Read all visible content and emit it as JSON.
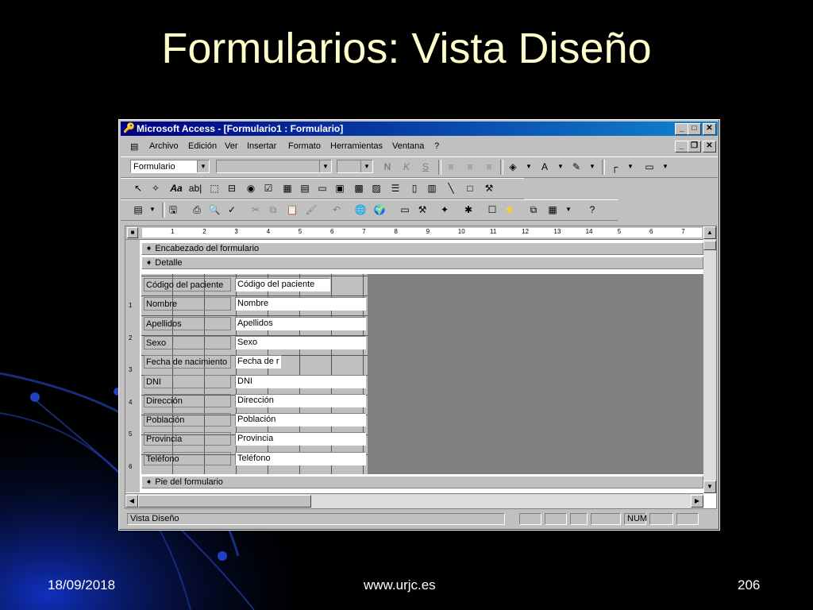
{
  "slide": {
    "title": "Formularios: Vista Diseño",
    "footer_date": "18/09/2018",
    "footer_url": "www.urjc.es",
    "footer_page": "206"
  },
  "window": {
    "title": "Microsoft Access - [Formulario1 : Formulario]"
  },
  "menu": [
    "Archivo",
    "Edición",
    "Ver",
    "Insertar",
    "Formato",
    "Herramientas",
    "Ventana",
    "?"
  ],
  "toolbar": {
    "object_combo": "Formulario",
    "font_combo": "",
    "size_combo": "",
    "bold": "N",
    "italic": "K",
    "underline": "S"
  },
  "design": {
    "header_section": "Encabezado del formulario",
    "detail_section": "Detalle",
    "footer_section": "Pie del formulario",
    "ruler_numbers": [
      "1",
      "2",
      "3",
      "4",
      "5",
      "6",
      "7",
      "8",
      "9",
      "10",
      "11",
      "12",
      "13",
      "14",
      "5",
      "6",
      "7"
    ],
    "left_ruler_numbers": [
      "1",
      "2",
      "3",
      "4",
      "5",
      "6"
    ],
    "fields": [
      {
        "label": "Código del paciente",
        "value": "Código del paciente"
      },
      {
        "label": "Nombre",
        "value": "Nombre"
      },
      {
        "label": "Apellidos",
        "value": "Apellidos"
      },
      {
        "label": "Sexo",
        "value": "Sexo"
      },
      {
        "label": "Fecha de nacimiento",
        "value": "Fecha de r"
      },
      {
        "label": "DNI",
        "value": "DNI"
      },
      {
        "label": "Dirección",
        "value": "Dirección"
      },
      {
        "label": "Población",
        "value": "Población"
      },
      {
        "label": "Provincia",
        "value": "Provincia"
      },
      {
        "label": "Teléfono",
        "value": "Teléfono"
      }
    ]
  },
  "status": {
    "mode": "Vista Diseño",
    "num": "NUM"
  }
}
